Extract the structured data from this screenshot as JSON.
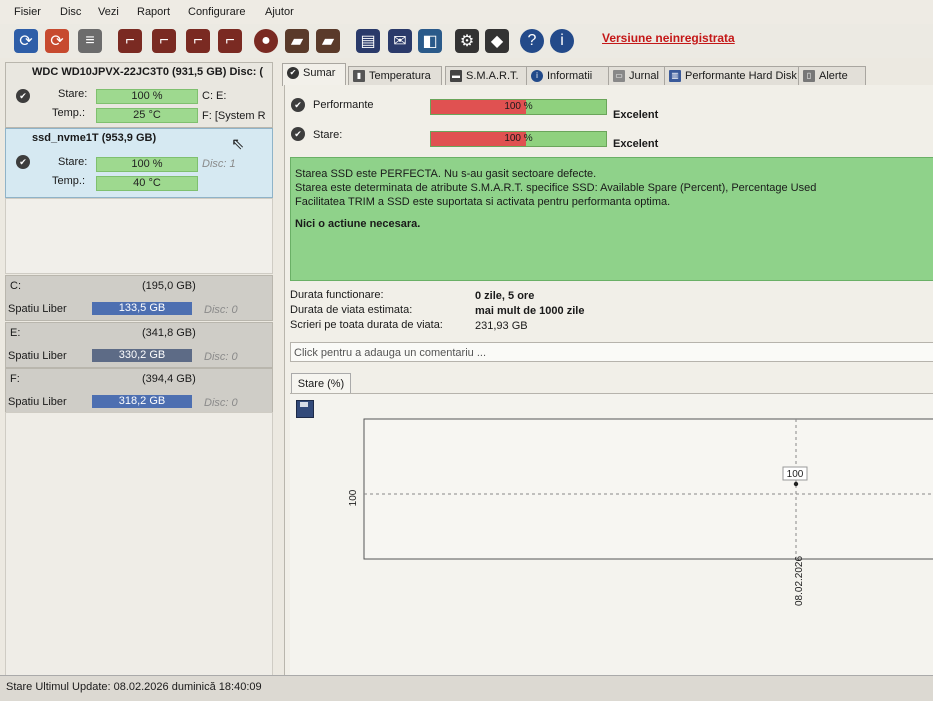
{
  "menu": [
    "Fisier",
    "Disc",
    "Vezi",
    "Raport",
    "Configurare",
    "Ajutor"
  ],
  "registration": "Versiune neinregistrata",
  "disks": [
    {
      "title": "WDC WD10JPVX-22JC3T0 (931,5 GB) Disc: (",
      "stare_label": "Stare:",
      "stare": "100 %",
      "temp_label": "Temp.:",
      "temp": "25 °C",
      "vol_line1": "C: E:",
      "vol_line2": "F: [System R"
    },
    {
      "title": "ssd_nvme1T (953,9 GB)",
      "stare_label": "Stare:",
      "stare": "100 %",
      "temp_label": "Temp.:",
      "temp": "40 °C",
      "disc": "Disc: 1"
    }
  ],
  "volumes": [
    {
      "letter": "C:",
      "size": "(195,0 GB)",
      "free_label": "Spatiu Liber",
      "free": "133,5 GB",
      "disc": "Disc: 0"
    },
    {
      "letter": "E:",
      "size": "(341,8 GB)",
      "free_label": "Spatiu Liber",
      "free": "330,2 GB",
      "disc": "Disc: 0"
    },
    {
      "letter": "F:",
      "size": "(394,4 GB)",
      "free_label": "Spatiu Liber",
      "free": "318,2 GB",
      "disc": "Disc: 0"
    }
  ],
  "tabs": [
    "Sumar",
    "Temperatura",
    "S.M.A.R.T.",
    "Informatii",
    "Jurnal",
    "Performante Hard Disk",
    "Alerte"
  ],
  "summary": {
    "performance_label": "Performante",
    "performance_value": "100 %",
    "performance_rating": "Excelent",
    "health_label": "Stare:",
    "health_value": "100 %",
    "health_rating": "Excelent",
    "message_lines": [
      "Starea SSD este PERFECTA. Nu s-au gasit sectoare defecte.",
      "Starea este determinata de atribute S.M.A.R.T. specifice SSD: Available Spare (Percent), Percentage Used",
      "Facilitatea TRIM a SSD este suportata si activata pentru performanta optima."
    ],
    "action": "Nici o actiune necesara.",
    "uptime_label": "Durata functionare:",
    "uptime": "0 zile, 5 ore",
    "lifetime_label": "Durata de viata estimata:",
    "lifetime": "mai mult de 1000 zile",
    "writes_label": "Scrieri pe toata durata de viata:",
    "writes": "231,93 GB",
    "comment_placeholder": "Click pentru a adauga un comentariu ..."
  },
  "chart_tab": "Stare (%)",
  "chart_data": {
    "type": "line",
    "title": "",
    "xlabel": "",
    "ylabel": "",
    "x": [
      "08.02.2026"
    ],
    "series": [
      {
        "values": [
          100
        ]
      }
    ],
    "y_tick": "100",
    "point_label": "100"
  },
  "statusbar": "Stare Ultimul Update: 08.02.2026 duminică 18:40:09"
}
